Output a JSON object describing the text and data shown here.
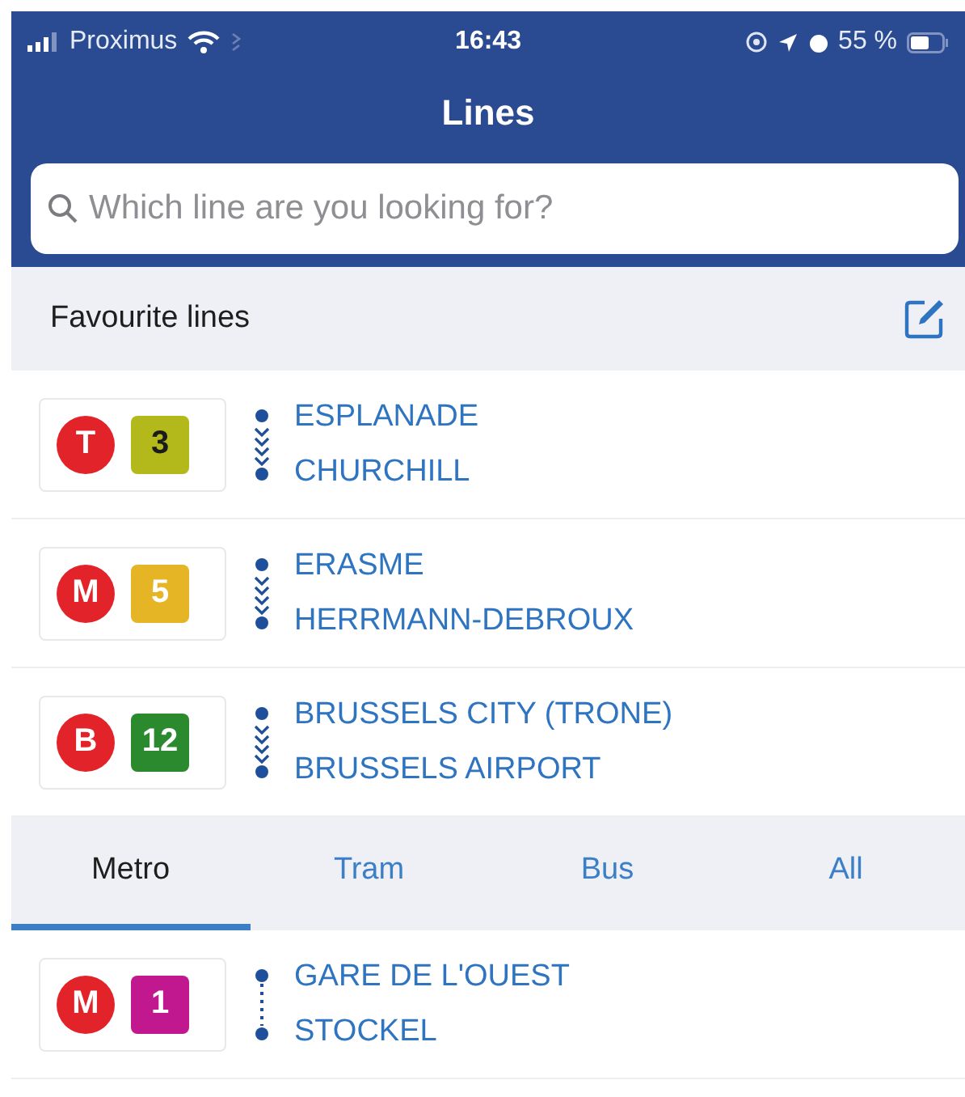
{
  "status_bar": {
    "carrier": "Proximus",
    "time": "16:43",
    "battery": "55 %"
  },
  "title": "Lines",
  "search": {
    "placeholder": "Which line are you looking for?"
  },
  "favourites": {
    "title": "Favourite lines",
    "lines": [
      {
        "mode": "T",
        "number": {
          "label": "3",
          "color": "#1b1b1b"
        },
        "color": "#b3b91a",
        "kind": "chevrons",
        "from": "ESPLANADE",
        "to": "CHURCHILL"
      },
      {
        "mode": "M",
        "number": {
          "label": "5",
          "color": "#ffffff"
        },
        "color": "#e6b526",
        "kind": "chevrons",
        "from": "ERASME",
        "to": "HERRMANN-DEBROUX"
      },
      {
        "mode": "B",
        "number": {
          "label": "12",
          "color": "#ffffff"
        },
        "color": "#2b8a2e",
        "kind": "chevrons",
        "from": "BRUSSELS CITY (TRONE)",
        "to": "BRUSSELS AIRPORT"
      }
    ]
  },
  "tabs": [
    {
      "label": "Metro",
      "selected": true
    },
    {
      "label": "Tram",
      "selected": false
    },
    {
      "label": "Bus",
      "selected": false
    },
    {
      "label": "All",
      "selected": false
    }
  ],
  "lines": [
    {
      "mode": "M",
      "number": {
        "label": "1",
        "color": "#ffffff"
      },
      "color": "#c2188f",
      "kind": "dotted",
      "from": "GARE DE L'OUEST",
      "to": "STOCKEL"
    }
  ]
}
